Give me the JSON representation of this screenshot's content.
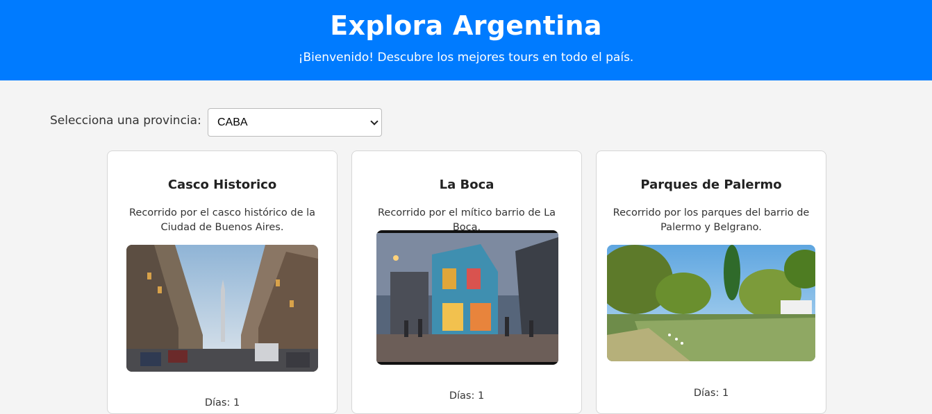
{
  "header": {
    "title": "Explora Argentina",
    "subtitle": "¡Bienvenido! Descubre los mejores tours en todo el país."
  },
  "selector": {
    "label": "Selecciona una provincia:",
    "selected": "CABA"
  },
  "tours": [
    {
      "title": "Casco Historico",
      "description": "Recorrido por el casco histórico de la Ciudad de Buenos Aires.",
      "image_icon": "city-street-photo",
      "days": "Días: 1"
    },
    {
      "title": "La Boca",
      "description": "Recorrido por el mítico barrio de La Boca.",
      "image_icon": "colorful-building-photo",
      "days": "Días: 1"
    },
    {
      "title": "Parques de Palermo",
      "description": "Recorrido por los parques del barrio de Palermo y Belgrano.",
      "image_icon": "park-lake-photo",
      "days": "Días: 1"
    }
  ],
  "colors": {
    "header_bg": "#007bff",
    "page_bg": "#f4f4f4"
  }
}
